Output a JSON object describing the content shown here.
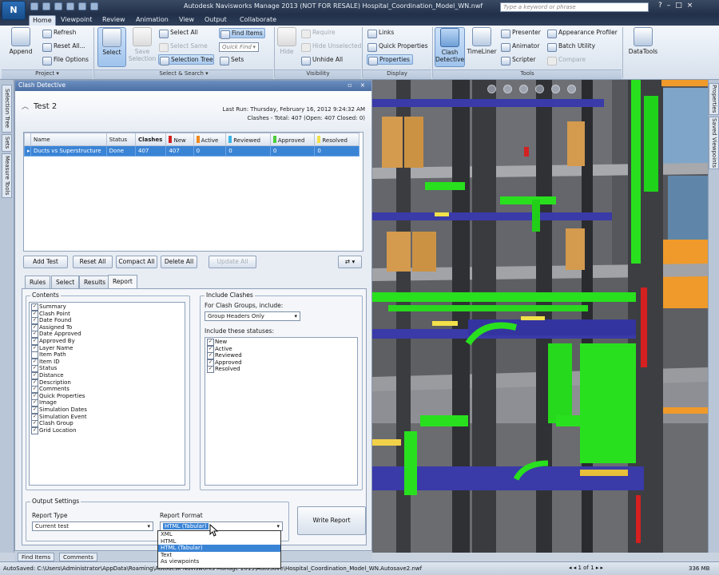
{
  "app": {
    "title": "Autodesk Navisworks Manage 2013 (NOT FOR RESALE)   Hospital_Coordination_Model_WN.nwf",
    "logo": "N",
    "search_placeholder": "Type a keyword or phrase"
  },
  "menu_tabs": [
    "Home",
    "Viewpoint",
    "Review",
    "Animation",
    "View",
    "Output",
    "Collaborate"
  ],
  "ribbon": {
    "project": {
      "append": "Append",
      "refresh": "Refresh",
      "reset_all": "Reset All...",
      "file_options": "File Options",
      "footer": "Project ▾"
    },
    "select_search": {
      "select": "Select",
      "save_selection": "Save Selection",
      "select_all": "Select All",
      "select_same": "Select Same",
      "selection_tree": "Selection Tree",
      "find_items": "Find Items",
      "quick_find": "Quick Find",
      "sets": "Sets",
      "footer": "Select & Search ▾"
    },
    "visibility": {
      "hide": "Hide",
      "require": "Require",
      "hide_unselected": "Hide Unselected",
      "unhide_all": "Unhide All",
      "footer": "Visibility"
    },
    "display": {
      "links": "Links",
      "quick_properties": "Quick Properties",
      "properties": "Properties",
      "footer": "Display"
    },
    "tools": {
      "clash_detective": "Clash Detective",
      "timeliner": "TimeLiner",
      "presenter": "Presenter",
      "animator": "Animator",
      "scripter": "Scripter",
      "appearance_profiler": "Appearance Profiler",
      "batch_utility": "Batch Utility",
      "compare": "Compare",
      "datatools": "DataTools",
      "footer": "Tools"
    }
  },
  "left_tabs": [
    "Selection Tree",
    "Sets",
    "Measure Tools"
  ],
  "right_tabs": [
    "Properties",
    "Saved Viewpoints"
  ],
  "panel": {
    "title": "Clash Detective",
    "test_name": "Test 2",
    "last_run": "Last Run:  Thursday, February 16, 2012 9:24:32 AM",
    "totals": "Clashes - Total: 407  (Open: 407  Closed: 0)",
    "grid": {
      "headers": [
        "Name",
        "Status",
        "Clashes",
        "New",
        "Active",
        "Reviewed",
        "Approved",
        "Resolved"
      ],
      "rows": [
        [
          "Ducts vs Superstructure",
          "Done",
          "407",
          "407",
          "0",
          "0",
          "0",
          "0"
        ]
      ]
    },
    "buttons": {
      "add_test": "Add Test",
      "reset_all": "Reset All",
      "compact_all": "Compact All",
      "delete_all": "Delete All",
      "update_all": "Update All"
    },
    "subtabs": [
      "Rules",
      "Select",
      "Results",
      "Report"
    ],
    "contents_label": "Contents",
    "contents": [
      {
        "label": "Summary",
        "checked": true
      },
      {
        "label": "Clash Point",
        "checked": true
      },
      {
        "label": "Date Found",
        "checked": true
      },
      {
        "label": "Assigned To",
        "checked": true
      },
      {
        "label": "Date Approved",
        "checked": true
      },
      {
        "label": "Approved By",
        "checked": true
      },
      {
        "label": "Layer Name",
        "checked": true
      },
      {
        "label": "Item Path",
        "checked": false
      },
      {
        "label": "Item ID",
        "checked": true
      },
      {
        "label": "Status",
        "checked": true
      },
      {
        "label": "Distance",
        "checked": true
      },
      {
        "label": "Description",
        "checked": true
      },
      {
        "label": "Comments",
        "checked": true
      },
      {
        "label": "Quick Properties",
        "checked": true
      },
      {
        "label": "Image",
        "checked": true
      },
      {
        "label": "Simulation Dates",
        "checked": true
      },
      {
        "label": "Simulation Event",
        "checked": true
      },
      {
        "label": "Clash Group",
        "checked": true
      },
      {
        "label": "Grid Location",
        "checked": true
      }
    ],
    "include_clashes_label": "Include Clashes",
    "clash_groups_label": "For Clash Groups, include:",
    "clash_groups_value": "Group Headers Only",
    "statuses_label": "Include these statuses:",
    "statuses": [
      {
        "label": "New",
        "checked": true
      },
      {
        "label": "Active",
        "checked": true
      },
      {
        "label": "Reviewed",
        "checked": true
      },
      {
        "label": "Approved",
        "checked": true
      },
      {
        "label": "Resolved",
        "checked": true
      }
    ],
    "output_settings_label": "Output Settings",
    "report_type_label": "Report Type",
    "report_type_value": "Current test",
    "report_format_label": "Report Format",
    "report_format_value": "HTML (Tabular)",
    "report_format_options": [
      "XML",
      "HTML",
      "HTML (Tabular)",
      "Text",
      "As viewpoints"
    ],
    "write_report": "Write Report"
  },
  "bottom_tabs": [
    "Find Items",
    "Comments"
  ],
  "status": {
    "autosave": "AutoSaved: C:\\Users\\Administrator\\AppData\\Roaming\\Autodesk Navisworks Manage 2013\\AutoSave\\Hospital_Coordination_Model_WN.Autosave2.nwf",
    "page": "1 of 1",
    "memory": "336 MB"
  },
  "colors": {
    "new": "#d42020",
    "active": "#f08a1e",
    "reviewed": "#3cb4e6",
    "approved": "#4ccc3a",
    "resolved": "#f2e14a",
    "duct_green": "#29e01e",
    "slab_blue": "#3a3aa8",
    "door": "#d49a4e",
    "ribbon_blue": "#3a84d6"
  }
}
